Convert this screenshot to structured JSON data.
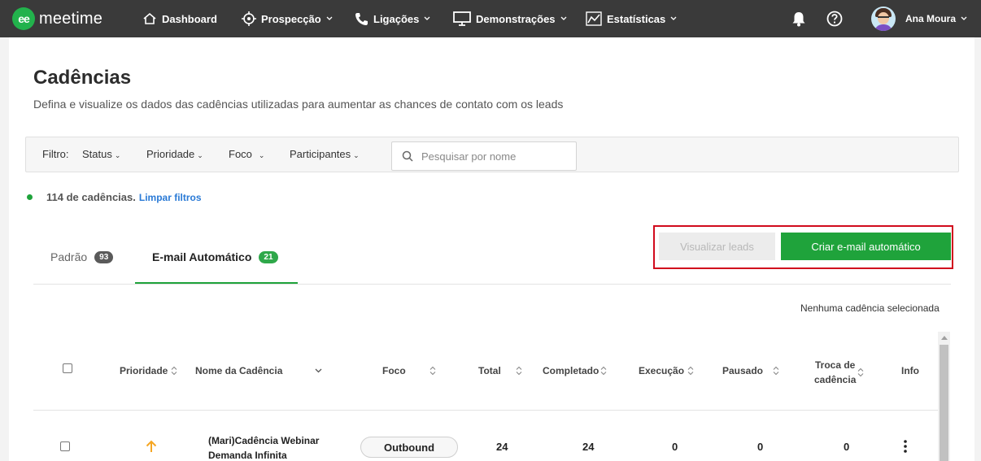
{
  "brand": {
    "name": "meetime",
    "logo_glyph": "ee",
    "color": "#22b24c"
  },
  "nav": {
    "dashboard": "Dashboard",
    "prospeccao": "Prospecção",
    "ligacoes": "Ligações",
    "demonstracoes": "Demonstrações",
    "estatisticas": "Estatísticas",
    "user": "Ana Moura"
  },
  "page": {
    "title": "Cadências",
    "subtitle": "Defina e visualize os dados das cadências utilizadas para aumentar as chances de contato com os leads"
  },
  "filters": {
    "label": "Filtro:",
    "status": "Status",
    "prioridade": "Prioridade",
    "foco": "Foco",
    "participantes": "Participantes",
    "search_placeholder": "Pesquisar por nome"
  },
  "summary": {
    "count": "114 de cadências.",
    "clear": "Limpar filtros"
  },
  "tabs": [
    {
      "label": "Padrão",
      "badge": "93",
      "badge_color": "#5a5a5a",
      "active": false
    },
    {
      "label": "E-mail Automático",
      "badge": "21",
      "badge_color": "#2fa84a",
      "active": true
    }
  ],
  "actions": {
    "view_leads": "Visualizar leads",
    "create": "Criar e-mail automático"
  },
  "selection_status": "Nenhuma cadência selecionada",
  "table": {
    "columns": {
      "prioridade": "Prioridade",
      "nome": "Nome da Cadência",
      "foco": "Foco",
      "total": "Total",
      "completado": "Completado",
      "execucao": "Execução",
      "pausado": "Pausado",
      "troca_1": "Troca de",
      "troca_2": "cadência",
      "info": "Info"
    },
    "rows": [
      {
        "priority_icon": "arrow-up-icon",
        "priority_color": "#f5a623",
        "name_1": "(Mari)Cadência Webinar",
        "name_2": "Demanda Infinita",
        "focus": "Outbound",
        "total": "24",
        "completado": "24",
        "execucao": "0",
        "pausado": "0",
        "troca": "0"
      }
    ]
  }
}
